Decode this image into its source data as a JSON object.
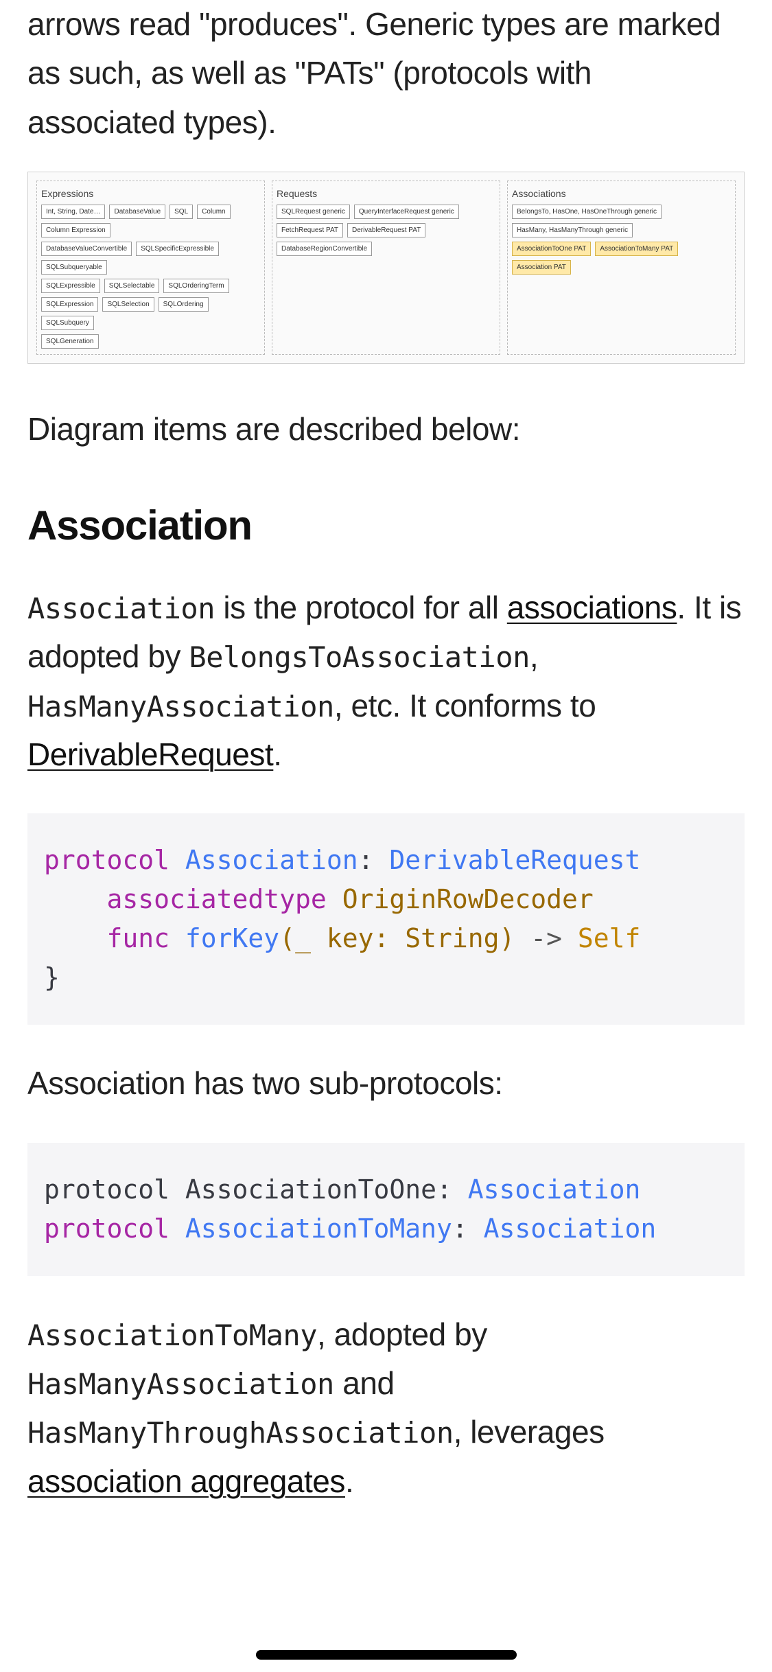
{
  "intro_tail": "arrows read \"produces\". Generic types are marked as such, as well as \"PATs\" (protocols with associated types).",
  "diagram": {
    "clusters": [
      {
        "title": "Expressions",
        "rows": [
          [
            "Int, String, Date…",
            "DatabaseValue",
            "SQL",
            "Column"
          ],
          [
            "Column Expression"
          ],
          [
            "DatabaseValueConvertible",
            "SQLSpecificExpressible",
            "SQLSubqueryable"
          ],
          [
            "SQLExpressible",
            "SQLSelectable",
            "SQLOrderingTerm"
          ],
          [
            "SQLExpression",
            "SQLSelection",
            "SQLOrdering",
            "SQLSubquery"
          ],
          [
            "SQLGeneration"
          ]
        ]
      },
      {
        "title": "Requests",
        "rows": [
          [
            "SQLRequest generic",
            "QueryInterfaceRequest generic"
          ],
          [
            "FetchRequest PAT",
            "DerivableRequest PAT"
          ],
          [
            "DatabaseRegionConvertible"
          ]
        ]
      },
      {
        "title": "Associations",
        "rows": [
          [
            "BelongsTo, HasOne, HasOneThrough generic",
            "HasMany, HasManyThrough generic"
          ],
          [
            "AssociationToOne PAT",
            "AssociationToMany PAT"
          ],
          [
            "Association PAT"
          ]
        ]
      }
    ]
  },
  "diagram_caption": "Diagram items are described below:",
  "section_title": "Association",
  "para1": {
    "code1": "Association",
    "t1": " is the protocol for all ",
    "link1": "associations",
    "t2": ". It is adopted by ",
    "code2": "BelongsToAssociation",
    "t3": ", ",
    "code3": "HasManyAssociation",
    "t4": ", etc. It conforms to ",
    "link2": "DerivableRequest",
    "t5": "."
  },
  "code1": {
    "l1_kw": "protocol",
    "l1_name": "Association",
    "l1_colon": ":",
    "l1_conform": "DerivableRequest",
    "l2_kw": "associatedtype",
    "l2_name": "OriginRowDecoder",
    "l3_kw": "func",
    "l3_name": "forKey",
    "l3_args": "(_ key: String)",
    "l3_arrow": "->",
    "l3_ret": "Self",
    "l4": "}"
  },
  "para2": "Association has two sub-protocols:",
  "code2": {
    "l1_kw": "protocol",
    "l1_name": "AssociationToOne",
    "l1_colon": ":",
    "l1_conform": "Association",
    "l2_kw": "protocol",
    "l2_name": "AssociationToMany",
    "l2_colon": ":",
    "l2_conform": "Association"
  },
  "para3": {
    "code1": "AssociationToMany",
    "t1": ", adopted by ",
    "code2": "HasManyAssociation",
    "t2": " and ",
    "code3": "HasManyThroughAssociation",
    "t3": ", leverages ",
    "link1": "association aggregates",
    "t4": "."
  }
}
